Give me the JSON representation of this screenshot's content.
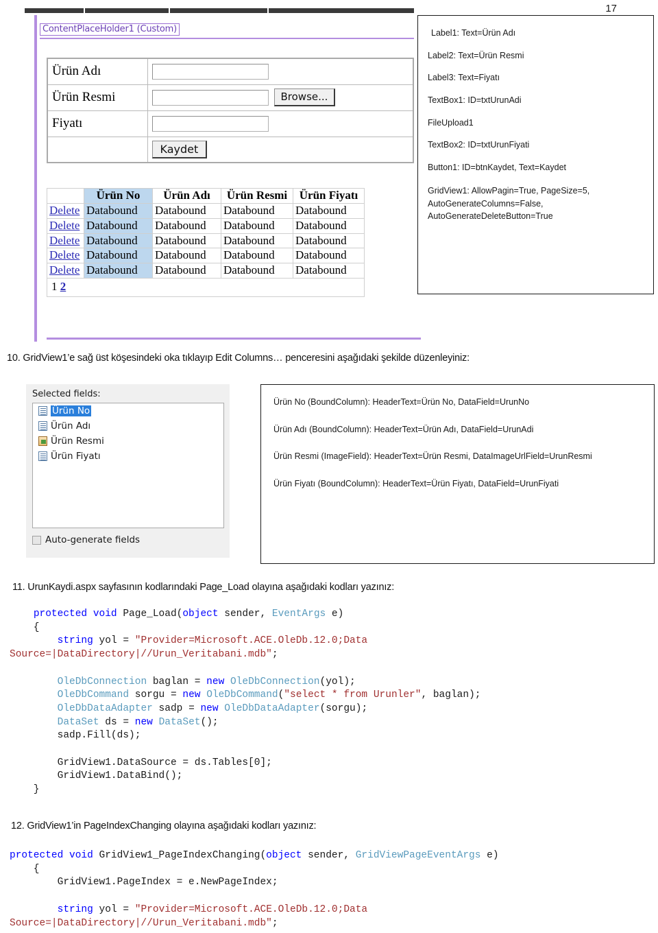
{
  "page": {
    "number": "17"
  },
  "designer": {
    "content_placeholder_tag": "ContentPlaceHolder1 (Custom)",
    "form_rows": [
      {
        "label": "Ürün Adı",
        "control": "textbox"
      },
      {
        "label": "Ürün Resmi",
        "control": "fileupload",
        "button": "Browse..."
      },
      {
        "label": "Fiyatı",
        "control": "textbox"
      },
      {
        "label": "",
        "control": "button",
        "button": "Kaydet"
      }
    ],
    "gridview": {
      "headers": [
        "",
        "Ürün No",
        "Ürün Adı",
        "Ürün Resmi",
        "Ürün Fiyatı"
      ],
      "delete_label": "Delete",
      "cell_text": "Databound",
      "row_count": 5,
      "pager": [
        "1",
        "2"
      ],
      "selected_column_color": "#bdd7ee"
    }
  },
  "notes_controls": {
    "lines": [
      "Label1: Text=Ürün Adı",
      "Label2: Text=Ürün Resmi",
      "Label3: Text=Fiyatı",
      "TextBox1: ID=txtUrunAdi",
      "FileUpload1",
      "TextBox2: ID=txtUrunFiyati",
      "Button1: ID=btnKaydet, Text=Kaydet",
      "GridView1: AllowPagin=True, PageSize=5,\nAutoGenerateColumns=False,\nAutoGenerateDeleteButton=True"
    ]
  },
  "steps": {
    "step10": "10. GridView1’e sağ üst köşesindeki oka tıklayıp Edit Columns… penceresini aşağıdaki şekilde düzenleyiniz:",
    "step11": "11. UrunKaydi.aspx sayfasının kodlarındaki Page_Load olayına aşağıdaki kodları yazınız:",
    "step12": "12. GridView1’in PageIndexChanging olayına aşağıdaki kodları yazınız:"
  },
  "edit_columns_dialog": {
    "title": "Selected fields:",
    "fields": [
      {
        "label": "Ürün No",
        "icon": "bound-column-icon",
        "selected": true
      },
      {
        "label": "Ürün Adı",
        "icon": "bound-column-icon",
        "selected": false
      },
      {
        "label": "Ürün Resmi",
        "icon": "image-field-icon",
        "selected": false
      },
      {
        "label": "Ürün Fiyatı",
        "icon": "bound-column-icon",
        "selected": false
      }
    ],
    "auto_generate_label": "Auto-generate fields",
    "auto_generate_checked": false
  },
  "notes_columns": {
    "lines": [
      "Ürün No (BoundColumn): HeaderText=Ürün No, DataField=UrunNo",
      "Ürün Adı (BoundColumn): HeaderText=Ürün Adı, DataField=UrunAdi",
      "Ürün Resmi (ImageField): HeaderText=Ürün Resmi, DataImageUrlField=UrunResmi",
      "Ürün Fiyatı (BoundColumn): HeaderText=Ürün Fiyatı, DataField=UrunFiyati"
    ]
  },
  "code_page_load": {
    "tokens": [
      {
        "t": "    ",
        "c": "pl"
      },
      {
        "t": "protected void ",
        "c": "kw"
      },
      {
        "t": "Page_Load(",
        "c": "pl"
      },
      {
        "t": "object",
        "c": "kw"
      },
      {
        "t": " sender, ",
        "c": "pl"
      },
      {
        "t": "EventArgs",
        "c": "ty"
      },
      {
        "t": " e)\n",
        "c": "pl"
      },
      {
        "t": "    {\n",
        "c": "pl"
      },
      {
        "t": "        ",
        "c": "pl"
      },
      {
        "t": "string",
        "c": "kw"
      },
      {
        "t": " yol = ",
        "c": "pl"
      },
      {
        "t": "\"Provider=Microsoft.ACE.OleDb.12.0;Data\nSource=|DataDirectory|//Urun_Veritabani.mdb\"",
        "c": "str"
      },
      {
        "t": ";\n\n",
        "c": "pl"
      },
      {
        "t": "        ",
        "c": "pl"
      },
      {
        "t": "OleDbConnection",
        "c": "ty"
      },
      {
        "t": " baglan = ",
        "c": "pl"
      },
      {
        "t": "new",
        "c": "kw"
      },
      {
        "t": " ",
        "c": "pl"
      },
      {
        "t": "OleDbConnection",
        "c": "ty"
      },
      {
        "t": "(yol);\n",
        "c": "pl"
      },
      {
        "t": "        ",
        "c": "pl"
      },
      {
        "t": "OleDbCommand",
        "c": "ty"
      },
      {
        "t": " sorgu = ",
        "c": "pl"
      },
      {
        "t": "new",
        "c": "kw"
      },
      {
        "t": " ",
        "c": "pl"
      },
      {
        "t": "OleDbCommand",
        "c": "ty"
      },
      {
        "t": "(",
        "c": "pl"
      },
      {
        "t": "\"select * from Urunler\"",
        "c": "str"
      },
      {
        "t": ", baglan);\n",
        "c": "pl"
      },
      {
        "t": "        ",
        "c": "pl"
      },
      {
        "t": "OleDbDataAdapter",
        "c": "ty"
      },
      {
        "t": " sadp = ",
        "c": "pl"
      },
      {
        "t": "new",
        "c": "kw"
      },
      {
        "t": " ",
        "c": "pl"
      },
      {
        "t": "OleDbDataAdapter",
        "c": "ty"
      },
      {
        "t": "(sorgu);\n",
        "c": "pl"
      },
      {
        "t": "        ",
        "c": "pl"
      },
      {
        "t": "DataSet",
        "c": "ty"
      },
      {
        "t": " ds = ",
        "c": "pl"
      },
      {
        "t": "new",
        "c": "kw"
      },
      {
        "t": " ",
        "c": "pl"
      },
      {
        "t": "DataSet",
        "c": "ty"
      },
      {
        "t": "();\n",
        "c": "pl"
      },
      {
        "t": "        sadp.Fill(ds);\n\n",
        "c": "pl"
      },
      {
        "t": "        GridView1.DataSource = ds.Tables[0];\n",
        "c": "pl"
      },
      {
        "t": "        GridView1.DataBind();\n",
        "c": "pl"
      },
      {
        "t": "    }",
        "c": "pl"
      }
    ]
  },
  "code_page_index_changing": {
    "tokens": [
      {
        "t": "protected void ",
        "c": "kw"
      },
      {
        "t": "GridView1_PageIndexChanging(",
        "c": "pl"
      },
      {
        "t": "object",
        "c": "kw"
      },
      {
        "t": " sender, ",
        "c": "pl"
      },
      {
        "t": "GridViewPageEventArgs",
        "c": "ty"
      },
      {
        "t": " e)\n",
        "c": "pl"
      },
      {
        "t": "    {\n",
        "c": "pl"
      },
      {
        "t": "        GridView1.PageIndex = e.NewPageIndex;\n\n",
        "c": "pl"
      },
      {
        "t": "        ",
        "c": "pl"
      },
      {
        "t": "string",
        "c": "kw"
      },
      {
        "t": " yol = ",
        "c": "pl"
      },
      {
        "t": "\"Provider=Microsoft.ACE.OleDb.12.0;Data\nSource=|DataDirectory|//Urun_Veritabani.mdb\"",
        "c": "str"
      },
      {
        "t": ";",
        "c": "pl"
      }
    ]
  }
}
